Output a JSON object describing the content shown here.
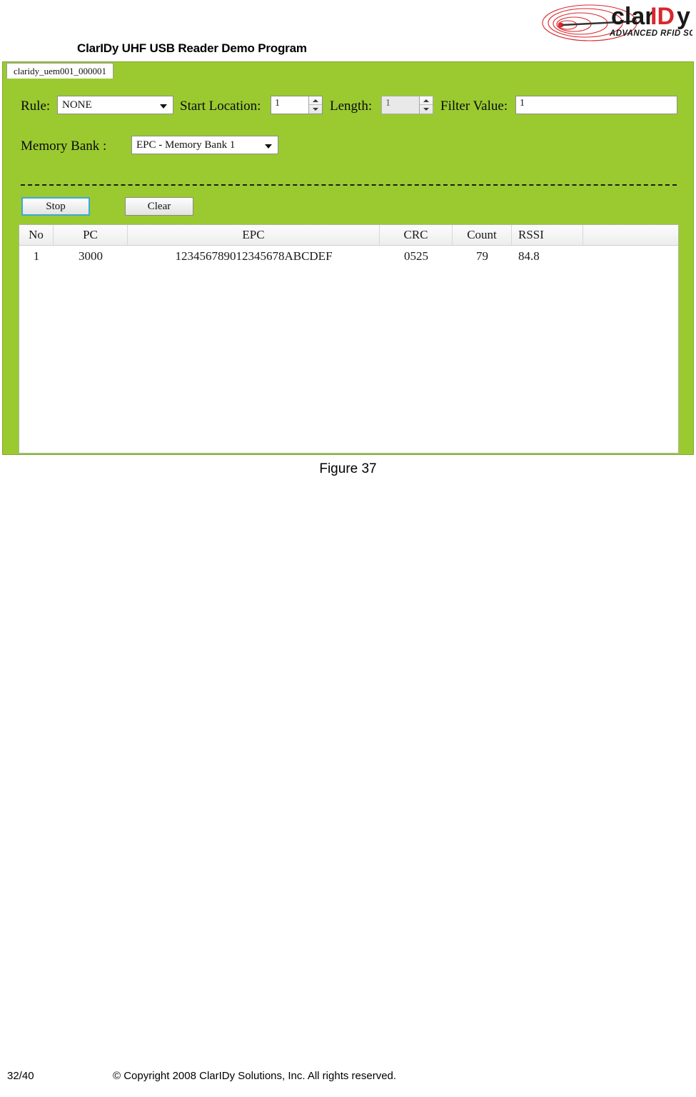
{
  "document": {
    "title": "ClarIDy UHF USB Reader Demo Program",
    "figure_caption": "Figure 37",
    "footer": {
      "page_number": "32/40",
      "copyright": "© Copyright 2008 ClarIDy Solutions, Inc. All rights reserved."
    }
  },
  "logo": {
    "text_part1": "clar",
    "text_part2": "ID",
    "text_part3": "y",
    "tagline": "ADVANCED RFID SOLUTIONS",
    "brand_black": "#1a1a1a",
    "brand_red": "#D9262C"
  },
  "app": {
    "accent_green": "#9ACA30",
    "tab": {
      "label": "claridy_uem001_000001"
    },
    "filters": {
      "rule_label": "Rule:",
      "rule_value": "NONE",
      "rule_options": [
        "NONE"
      ],
      "start_location_label": "Start Location:",
      "start_location_value": "1",
      "length_label": "Length:",
      "length_value": "1",
      "filter_value_label": "Filter Value:",
      "filter_value_value": "1"
    },
    "memory_bank": {
      "label": "Memory Bank :",
      "value": "EPC - Memory Bank 1",
      "options": [
        "EPC - Memory Bank 1"
      ]
    },
    "buttons": {
      "stop": "Stop",
      "clear": "Clear"
    },
    "grid": {
      "columns": [
        "No",
        "PC",
        "EPC",
        "CRC",
        "Count",
        "RSSI",
        ""
      ],
      "rows": [
        {
          "no": "1",
          "pc": "3000",
          "epc": "123456789012345678ABCDEF",
          "crc": "0525",
          "count": "79",
          "rssi": "84.8",
          "pad": ""
        }
      ]
    }
  }
}
